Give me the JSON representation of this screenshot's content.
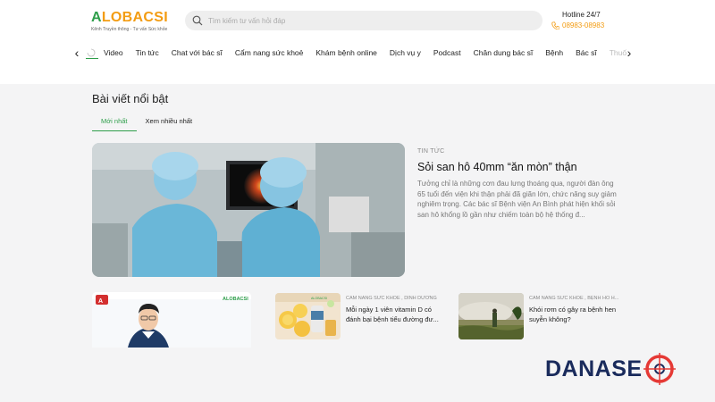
{
  "logo": {
    "brand_a": "A",
    "brand_rest": "LOBACSI",
    "tagline": "Kênh Truyền thông - Tư vấn Sức khỏe"
  },
  "search": {
    "placeholder": "Tìm kiếm tư vấn hỏi đáp"
  },
  "hotline": {
    "label": "Hotline 24/7",
    "phone": "08983-08983"
  },
  "nav": {
    "items": [
      "Video",
      "Tin tức",
      "Chat với bác sĩ",
      "Cẩm nang sức khoẻ",
      "Khám bệnh online",
      "Dịch vụ y",
      "Podcast",
      "Chân dung bác sĩ",
      "Bệnh",
      "Bác sĩ",
      "Thuốc"
    ]
  },
  "section": {
    "title": "Bài viết nổi bật",
    "tabs": [
      "Mới nhất",
      "Xem nhiều nhất"
    ]
  },
  "featured": {
    "category": "TIN TỨC",
    "title": "Sỏi san hô 40mm “ăn mòn” thận",
    "description": "Tưởng chỉ là những cơn đau lưng thoáng qua, người đàn ông 65 tuổi đến viện khi thận phải đã giãn lớn, chức năng suy giảm nghiêm trọng. Các bác sĩ Bệnh viện An Bình phát hiện khối sỏi san hô khổng lồ gần như chiếm toàn bộ hệ thống đ..."
  },
  "cards": [
    {
      "category": "CẨM NANG SỨC KHOẺ , DINH DƯỠNG",
      "title": "Mỗi ngày 1 viên vitamin D có đánh bại bệnh tiểu đường đư..."
    },
    {
      "category": "CẨM NANG SỨC KHOẺ , BỆNH HÔ H...",
      "title": "Khói rơm có gây ra bệnh hen suyễn không?"
    }
  ],
  "video_card": {
    "logo_text": "ALOBACSI"
  },
  "watermark": {
    "text": "DANASE"
  },
  "colors": {
    "brand_green": "#2e9e4a",
    "brand_orange": "#f39c12",
    "watermark_red": "#e53935",
    "watermark_navy": "#1a2b5c"
  }
}
